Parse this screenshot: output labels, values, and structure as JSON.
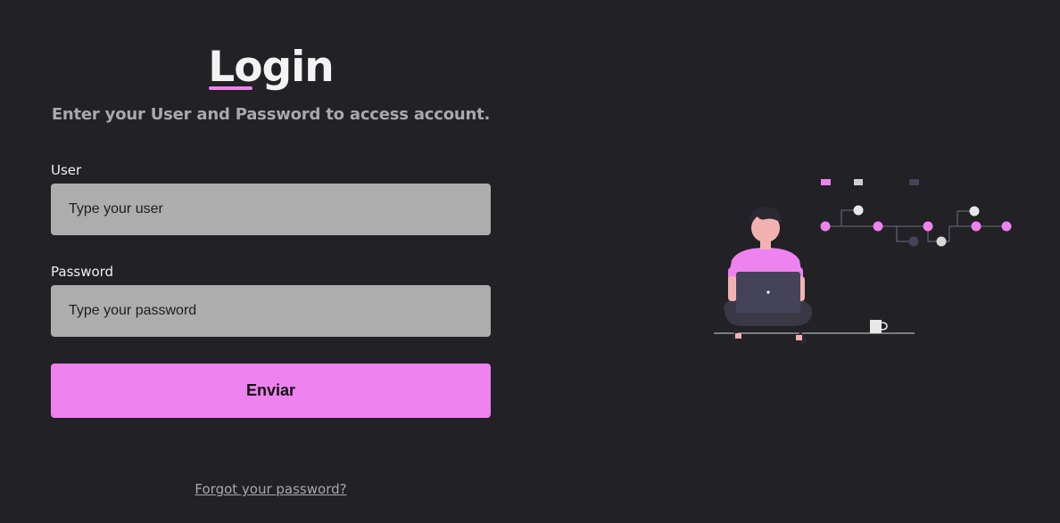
{
  "login": {
    "title": "Login",
    "subtitle": "Enter your User and Password to access account.",
    "user_label": "User",
    "user_placeholder": "Type your user",
    "password_label": "Password",
    "password_placeholder": "Type your password",
    "submit_label": "Enviar",
    "forgot_link": "Forgot your password?"
  },
  "colors": {
    "background": "#212126",
    "accent": "#ee82ee",
    "input_background": "#adadad",
    "muted_text": "#a9a9ab"
  },
  "illustration": {
    "name": "person-with-laptop-illustration"
  }
}
